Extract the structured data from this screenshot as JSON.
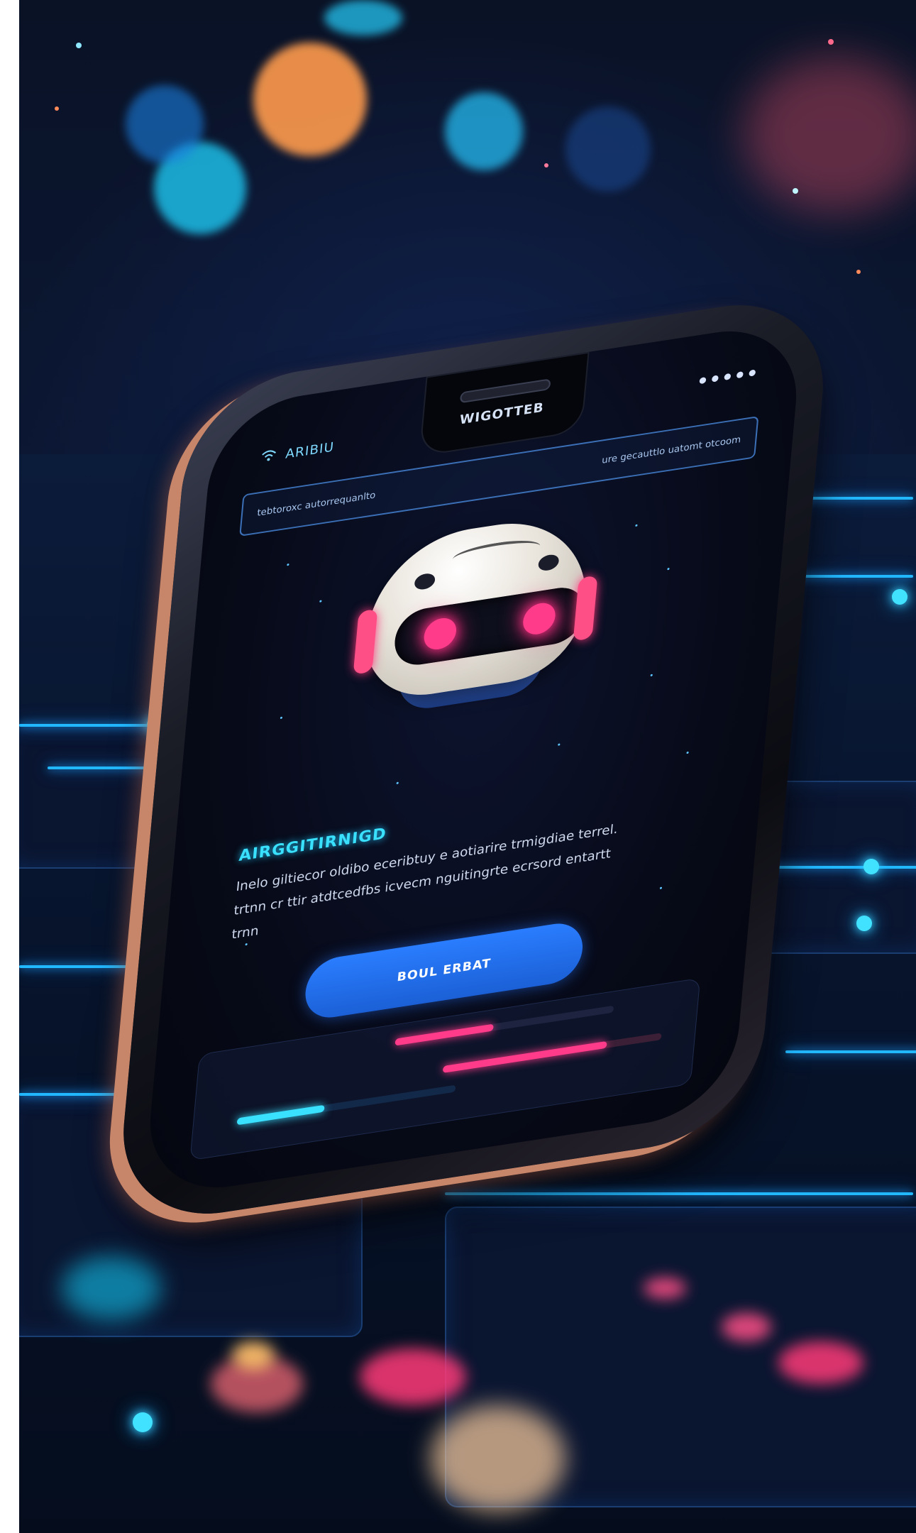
{
  "scene": {
    "accent_cyan": "#39e1ff",
    "accent_pink": "#ff3b8a",
    "accent_blue": "#2a7dff"
  },
  "phone": {
    "status_left": "ARIBIU",
    "status_title": "WIGOTTEB",
    "signal_icon": "wifi-icon",
    "infobar_left": "tebtoroxc autorrequanlto",
    "infobar_right": "ure gecauttlo uatomt otcoom",
    "robot_icon": "robot-head",
    "heading": "AIRGGITIRNIGD",
    "body": "Inelo giltiecor oldibo eceribtuy e aotiarire trmigdiae terrel. trtnn cr ttir atdtcedfbs icvecm nguitingrte ecrsord entartt trnn",
    "cta_label": "BOUL ERBAT",
    "bars": {
      "pink_top_level": 0.45,
      "pink_bottom_level": 0.75,
      "cyan_level": 0.4
    }
  }
}
